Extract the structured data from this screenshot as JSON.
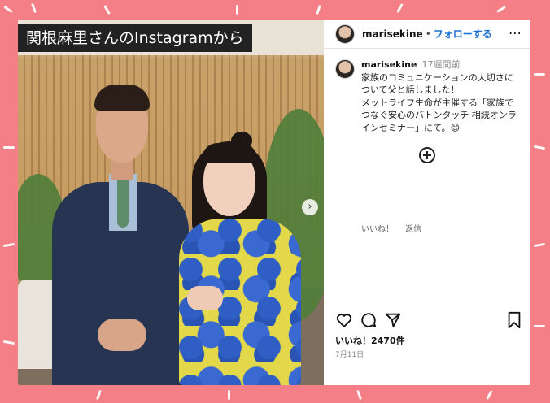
{
  "banner": {
    "title": "関根麻里さんのInstagramから"
  },
  "post": {
    "username": "marisekine",
    "separator": "•",
    "follow_label": "フォローする",
    "more_label": "⋯",
    "caption": {
      "username": "marisekine",
      "time_ago": "17週間前",
      "lines": [
        "家族のコミュニケーションの大切さに",
        "ついて父と話しました！",
        "メットライフ生命が主催する「家族で",
        "つなぐ安心のバトンタッチ 相続オンラ",
        "インセミナー」にて。😊"
      ]
    },
    "comment_actions": {
      "like": "いいね！",
      "reply": "返信"
    },
    "likes_label": "いいね！2470件",
    "date": "7月11日"
  },
  "carousel": {
    "next_label": "›"
  },
  "colors": {
    "background": "#f47f86",
    "follow_blue": "#1a6fd3",
    "title_band": "#222222"
  },
  "icons": [
    "more-options-icon",
    "add-comment-icon",
    "heart-icon",
    "comment-icon",
    "share-icon",
    "bookmark-icon",
    "carousel-next-icon"
  ]
}
